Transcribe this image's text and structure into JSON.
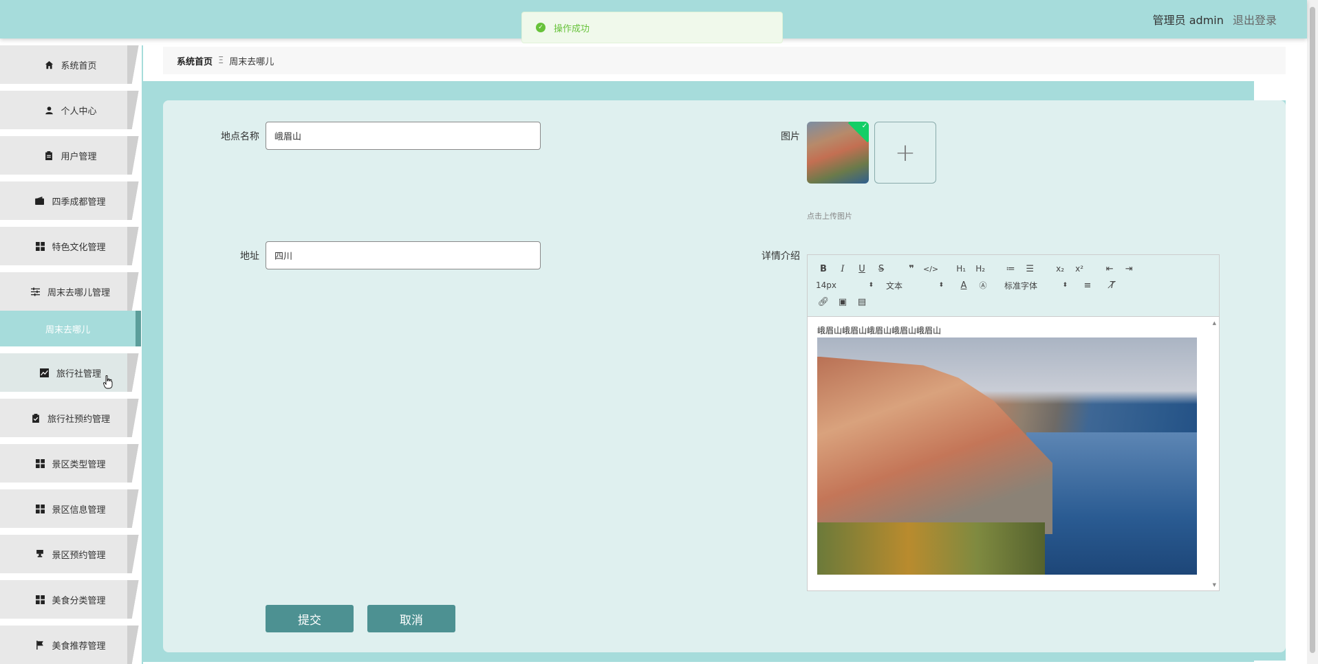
{
  "header": {
    "user_label": "管理员 admin",
    "logout_label": "退出登录"
  },
  "toast": {
    "message": "操作成功"
  },
  "sidebar": {
    "items": [
      {
        "label": "系统首页",
        "icon": "home-icon"
      },
      {
        "label": "个人中心",
        "icon": "user-icon"
      },
      {
        "label": "用户管理",
        "icon": "clipboard-icon"
      },
      {
        "label": "四季成都管理",
        "icon": "wallet-icon"
      },
      {
        "label": "特色文化管理",
        "icon": "grid-icon"
      },
      {
        "label": "周末去哪儿管理",
        "icon": "sliders-icon"
      },
      {
        "label": "周末去哪儿",
        "icon": ""
      },
      {
        "label": "旅行社管理",
        "icon": "chart-icon"
      },
      {
        "label": "旅行社预约管理",
        "icon": "clipboard-check-icon"
      },
      {
        "label": "景区类型管理",
        "icon": "grid-icon"
      },
      {
        "label": "景区信息管理",
        "icon": "grid-icon"
      },
      {
        "label": "景区预约管理",
        "icon": "stamp-icon"
      },
      {
        "label": "美食分类管理",
        "icon": "grid-icon"
      },
      {
        "label": "美食推荐管理",
        "icon": "flag-icon"
      }
    ],
    "active_index": 6
  },
  "breadcrumb": {
    "home": "系统首页",
    "separator": "Ξ",
    "current": "周末去哪儿"
  },
  "form": {
    "place_name_label": "地点名称",
    "place_name_value": "峨眉山",
    "address_label": "地址",
    "address_value": "四川",
    "image_label": "图片",
    "upload_tip": "点击上传图片",
    "upload_plus": "+",
    "detail_label": "详情介绍",
    "submit_label": "提交",
    "cancel_label": "取消"
  },
  "editor": {
    "font_size": "14px",
    "header_select": "文本",
    "font_family": "标准字体",
    "content_text": "峨眉山峨眉山峨眉山峨眉山峨眉山"
  },
  "colors": {
    "theme": "#a6dcdb",
    "panel": "#dff0ef",
    "button": "#4d9192",
    "success": "#67c23a"
  }
}
